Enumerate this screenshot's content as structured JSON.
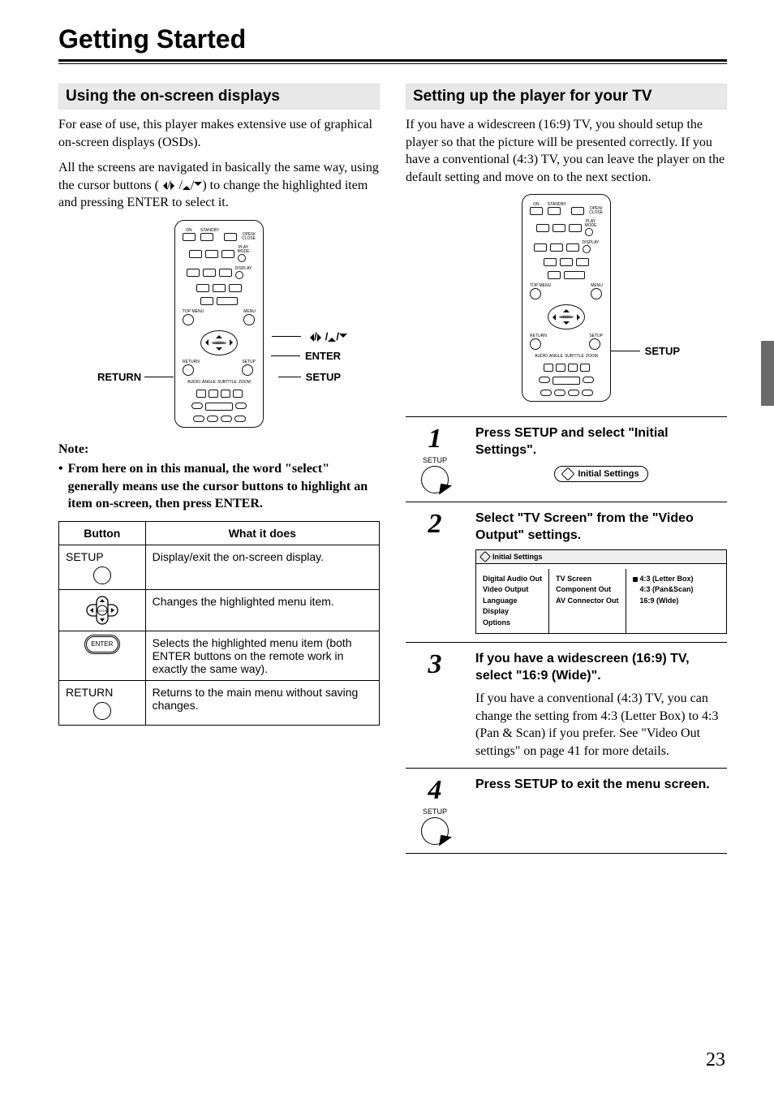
{
  "chapter_title": "Getting Started",
  "page_number": "23",
  "left": {
    "heading": "Using the on-screen displays",
    "para1": "For ease of use, this player makes extensive use of graphical on-screen displays (OSDs).",
    "para2_pre": "All the screens are navigated in basically the same way, using the cursor buttons (",
    "para2_post": ") to change the highlighted item and pressing ENTER to select it.",
    "callouts": {
      "return": "RETURN",
      "arrows_label": "◄/►/▲/▼",
      "enter": "ENTER",
      "setup": "SETUP"
    },
    "note_heading": "Note:",
    "note_bullet": "From here on in this manual, the word \"select\" generally means use the cursor buttons to highlight an item on-screen, then press ENTER.",
    "table": {
      "col1": "Button",
      "col2": "What it does",
      "rows": [
        {
          "btn_label": "SETUP",
          "btn_kind": "circle",
          "desc": "Display/exit the on-screen display."
        },
        {
          "btn_label": "",
          "btn_kind": "dpad",
          "desc": "Changes the highlighted menu item."
        },
        {
          "btn_label": "",
          "btn_kind": "enter",
          "desc": "Selects the highlighted menu item (both ENTER buttons on the remote work in exactly the same way)."
        },
        {
          "btn_label": "RETURN",
          "btn_kind": "circle",
          "desc": "Returns to the main menu without saving changes."
        }
      ]
    }
  },
  "right": {
    "heading": "Setting up the player for your TV",
    "para1": "If you have a widescreen (16:9) TV, you should setup the player so that the picture will be presented correctly. If you have a conventional (4:3) TV, you can leave the player on the default setting and move on to the next section.",
    "callout_setup": "SETUP",
    "steps": [
      {
        "num": "1",
        "icon_label": "SETUP",
        "show_icon": true,
        "title": "Press SETUP and select \"Initial Settings\".",
        "osd_pill": "Initial Settings"
      },
      {
        "num": "2",
        "icon_label": "",
        "show_icon": false,
        "title": "Select \"TV Screen\" from the \"Video Output\" settings.",
        "osd": {
          "header": "Initial Settings",
          "col1": [
            "Digital Audio Out",
            "Video Output",
            "Language",
            "Display",
            "Options"
          ],
          "col2": [
            "TV Screen",
            "Component Out",
            "AV Connector Out"
          ],
          "col3": [
            "4:3 (Letter Box)",
            "4:3 (Pan&Scan)",
            "16:9 (Wide)"
          ]
        }
      },
      {
        "num": "3",
        "icon_label": "",
        "show_icon": false,
        "title": "If you have a widescreen (16:9) TV, select \"16:9 (Wide)\".",
        "para": "If you have a conventional (4:3) TV, you can change the setting from 4:3 (Letter Box) to 4:3 (Pan & Scan) if you prefer. See \"Video Out settings\" on page 41 for more details."
      },
      {
        "num": "4",
        "icon_label": "SETUP",
        "show_icon": true,
        "title": "Press SETUP to exit the menu screen."
      }
    ]
  },
  "remote_labels": {
    "on": "ON",
    "standby": "STANDBY",
    "open_close": "OPEN/\nCLOSE",
    "play_mode": "PLAY\nMODE",
    "display": "DISPLAY",
    "top_menu": "TOP MENU",
    "menu": "MENU",
    "return": "RETURN",
    "setup": "SETUP",
    "enter": "ENTER",
    "audio": "AUDIO",
    "angle": "ANGLE",
    "subtitle": "SUBTITLE",
    "zoom": "ZOOM"
  }
}
